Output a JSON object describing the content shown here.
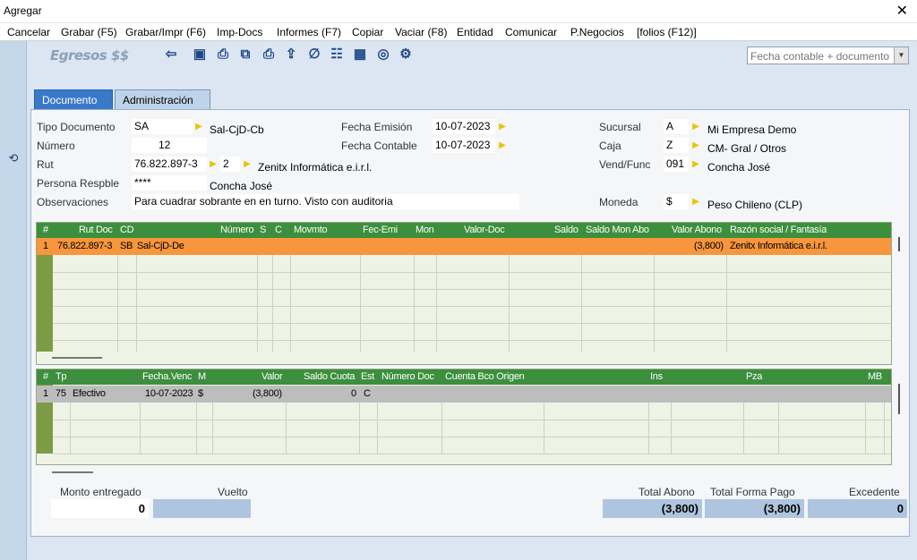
{
  "window": {
    "title": "Agregar",
    "close": "✕"
  },
  "menu": [
    "Cancelar",
    "Grabar (F5)",
    "Grabar/Impr (F6)",
    "Imp-Docs",
    "Informes (F7)",
    "Copiar",
    "Vaciar (F8)",
    "Entidad",
    "Comunicar",
    "P.Negocios",
    "[folios (F12)]"
  ],
  "toolbar": {
    "module": "Egresos $$",
    "combo_value": "Fecha contable + documento"
  },
  "tabs": [
    "Documento",
    "Administración"
  ],
  "form": {
    "tipo_documento": {
      "label": "Tipo Documento",
      "code": "SA",
      "desc": "Sal-CjD-Cb"
    },
    "numero": {
      "label": "Número",
      "value": "12"
    },
    "rut": {
      "label": "Rut",
      "value": "76.822.897-3",
      "dv": "2",
      "name": "Zenitx Informática e.i.r.l."
    },
    "persona": {
      "label": "Persona Respble",
      "value": "****",
      "name": "Concha José"
    },
    "observaciones": {
      "label": "Observaciones",
      "value": "Para cuadrar sobrante en en turno. Visto con auditoria"
    },
    "fecha_emision": {
      "label": "Fecha Emisión",
      "value": "10-07-2023"
    },
    "fecha_contable": {
      "label": "Fecha Contable",
      "value": "10-07-2023"
    },
    "sucursal": {
      "label": "Sucursal",
      "code": "A",
      "desc": "Mi Empresa Demo"
    },
    "caja": {
      "label": "Caja",
      "code": "Z",
      "desc": "CM- Gral / Otros"
    },
    "vend": {
      "label": "Vend/Func",
      "code": "091",
      "desc": "Concha José"
    },
    "moneda": {
      "label": "Moneda",
      "code": "$",
      "desc": "Peso Chileno (CLP)"
    }
  },
  "grid1": {
    "headers": [
      "#",
      "Rut Doc",
      "CD",
      "Número",
      "S",
      "C",
      "Movmto",
      "Fec-Emi",
      "Mon",
      "Valor-Doc",
      "Saldo",
      "Saldo Mon Abo",
      "Valor Abono",
      "Razón social / Fantasía"
    ],
    "row": {
      "n": "1",
      "rut": "76.822.897-3",
      "cd": "SB",
      "desc": "Sal-CjD-De",
      "valor_abono": "(3,800)",
      "razon": "Zenitx Informática e.i.r.l."
    }
  },
  "grid2": {
    "headers": [
      "#",
      "Tp",
      "Fecha.Venc",
      "M",
      "Valor",
      "Saldo Cuota",
      "Est",
      "Número Doc",
      "Cuenta Bco Origen",
      "Ins",
      "Pza",
      "MB"
    ],
    "row": {
      "n": "1",
      "tp": "75",
      "desc": "Efectivo",
      "fecha": "10-07-2023",
      "m": "$",
      "valor": "(3,800)",
      "saldo": "0",
      "est": "C"
    }
  },
  "summary": {
    "monto_entregado": {
      "label": "Monto entregado",
      "value": "0"
    },
    "vuelto": {
      "label": "Vuelto",
      "value": ""
    },
    "total_abono": {
      "label": "Total Abono",
      "value": "(3,800)"
    },
    "total_forma_pago": {
      "label": "Total Forma Pago",
      "value": "(3,800)"
    },
    "excedente": {
      "label": "Excedente",
      "value": "0"
    }
  },
  "colors": {
    "accent": "#3a79c9",
    "grid_header": "#3c8f3c",
    "row_selected": "#f7963c",
    "row_gray": "#bdbdbd",
    "summary_box": "#afc5df"
  }
}
